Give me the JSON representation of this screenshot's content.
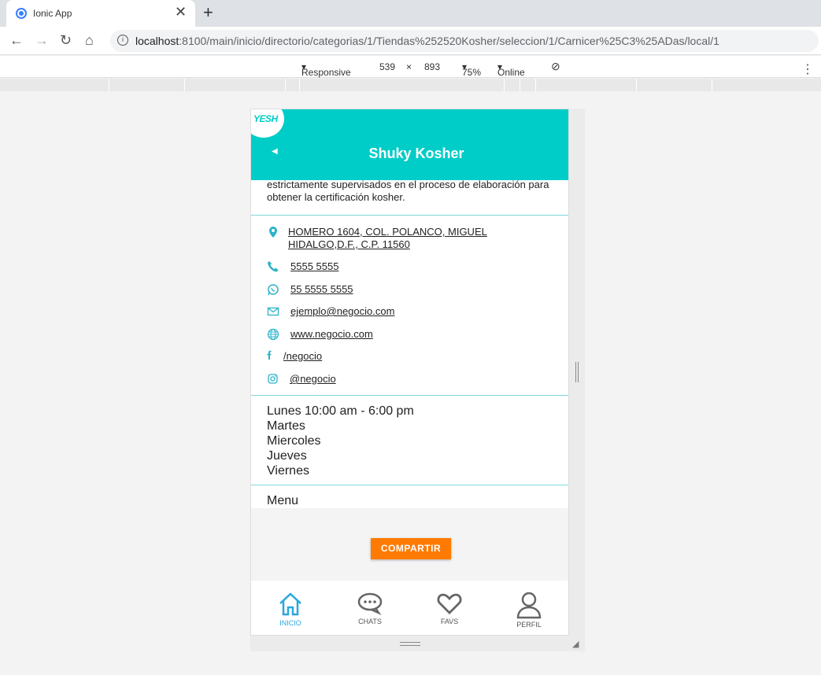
{
  "browser": {
    "tab_title": "Ionic App",
    "tab_close": "✕",
    "new_tab": "+",
    "url_host": "localhost",
    "url_path": ":8100/main/inicio/directorio/categorias/1/Tiendas%252520Kosher/seleccion/1/Carnicer%25C3%25ADas/local/1"
  },
  "devtools": {
    "device": "Responsive",
    "width": "539",
    "times": "×",
    "height": "893",
    "zoom": "75%",
    "network": "Online"
  },
  "app": {
    "logo_text": "YESH",
    "title": "Shuky Kosher",
    "description": "estrictamente supervisados en el proceso de elaboración para obtener la certificación kosher.",
    "contacts": {
      "address": "HOMERO 1604, COL. POLANCO, MIGUEL HIDALGO,D.F., C.P. 11560",
      "phone": "5555 5555",
      "whatsapp": "55 5555 5555",
      "email": "ejemplo@negocio.com",
      "website": "www.negocio.com",
      "facebook": "/negocio",
      "instagram": "@negocio"
    },
    "hours": [
      "Lunes 10:00 am - 6:00 pm",
      "Martes",
      "Miercoles",
      "Jueves",
      "Viernes"
    ],
    "menu_label": "Menu",
    "share_label": "COMPARTIR",
    "tabs": [
      {
        "label": "INICIO",
        "icon": "home-icon",
        "active": true
      },
      {
        "label": "CHATS",
        "icon": "chat-icon",
        "active": false
      },
      {
        "label": "FAVS",
        "icon": "heart-icon",
        "active": false
      },
      {
        "label": "PERFIL",
        "icon": "person-icon",
        "active": false
      }
    ],
    "colors": {
      "header": "#00cdc8",
      "accent": "#2aa7e0",
      "share": "#ff7a00"
    }
  }
}
